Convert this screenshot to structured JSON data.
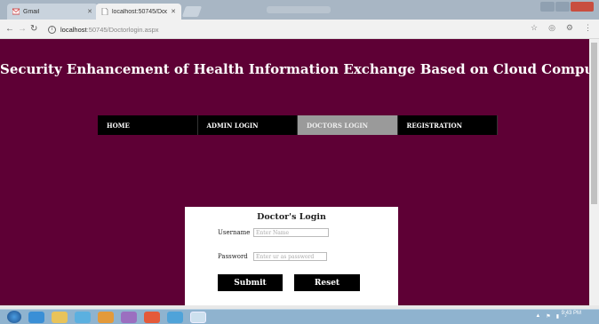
{
  "browser": {
    "tabs": [
      {
        "label": "Gmail",
        "active": false
      },
      {
        "label": "localhost:50745/Doctorl",
        "active": true
      }
    ],
    "address": {
      "host": "localhost",
      "path": ":50745/Doctorlogin.aspx"
    }
  },
  "site": {
    "title": "Security Enhancement of Health Information Exchange Based on Cloud Computing System",
    "background": "#5e0035",
    "menu": [
      {
        "label": "HOME"
      },
      {
        "label": "ADMIN LOGIN"
      },
      {
        "label": "DOCTORS LOGIN",
        "active": true
      },
      {
        "label": "REGISTRATION"
      }
    ]
  },
  "login": {
    "title": "Doctor's Login",
    "username_label": "Username",
    "username_placeholder": "Enter Name",
    "password_label": "Password",
    "password_placeholder": "Enter ur as password",
    "submit_label": "Submit",
    "reset_label": "Reset"
  },
  "taskbar": {
    "clock_time": "9:43 PM"
  }
}
